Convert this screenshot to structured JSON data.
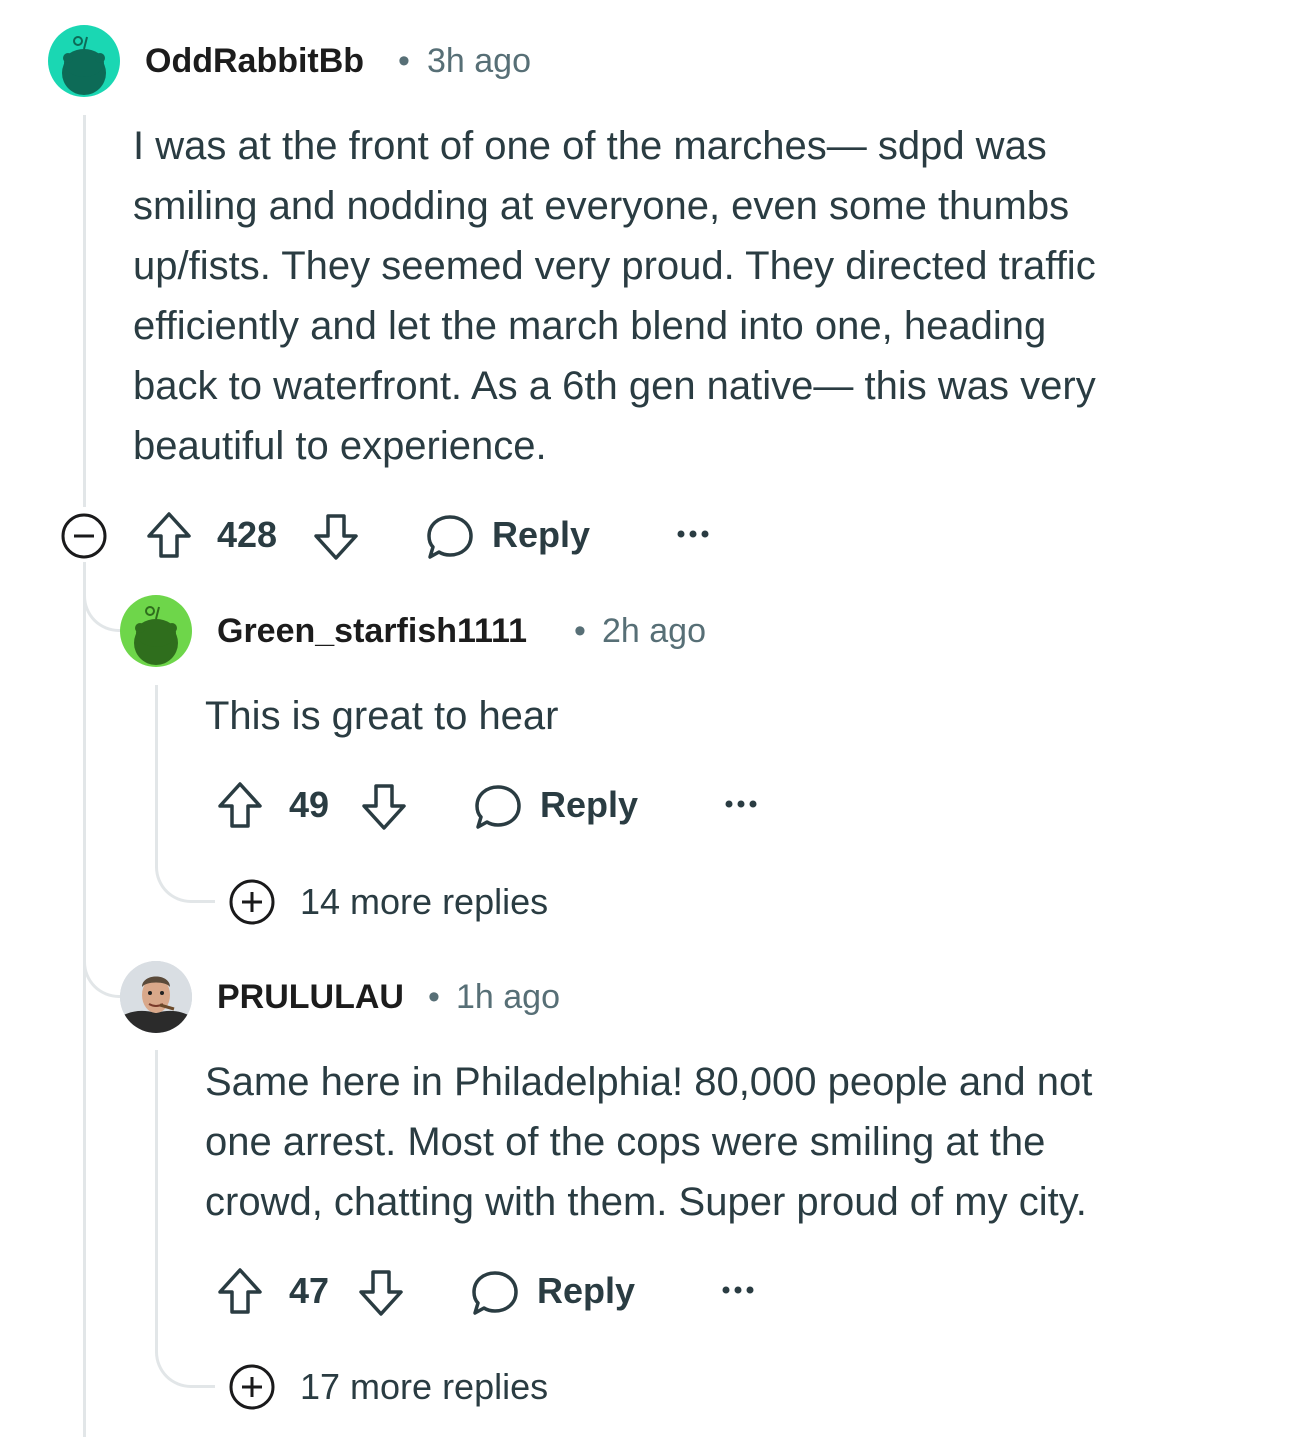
{
  "comments": [
    {
      "username": "OddRabbitBb",
      "time": "3h ago",
      "avatar_color": "#1ad7b3",
      "body_lines": [
        "I was at the front of one of the marches— sdpd was",
        "smiling and nodding at everyone, even some thumbs",
        "up/fists. They seemed very proud. They directed traffic",
        "efficiently and let the march blend into one, heading",
        "back to waterfront. As a 6th gen native— this was very",
        "beautiful to experience."
      ],
      "votes": "428",
      "reply_label": "Reply"
    },
    {
      "username": "Green_starfish1111",
      "time": "2h ago",
      "avatar_color": "#6ed64a",
      "body_lines": [
        "This is great to hear"
      ],
      "votes": "49",
      "reply_label": "Reply",
      "more_replies": "14 more replies"
    },
    {
      "username": "PRULULAU",
      "time": "1h ago",
      "body_lines": [
        "Same here in Philadelphia! 80,000 people and not",
        "one arrest. Most of the cops were smiling at the",
        "crowd, chatting with them. Super proud of my city."
      ],
      "votes": "47",
      "reply_label": "Reply",
      "more_replies": "17 more replies"
    }
  ],
  "separator": "•"
}
